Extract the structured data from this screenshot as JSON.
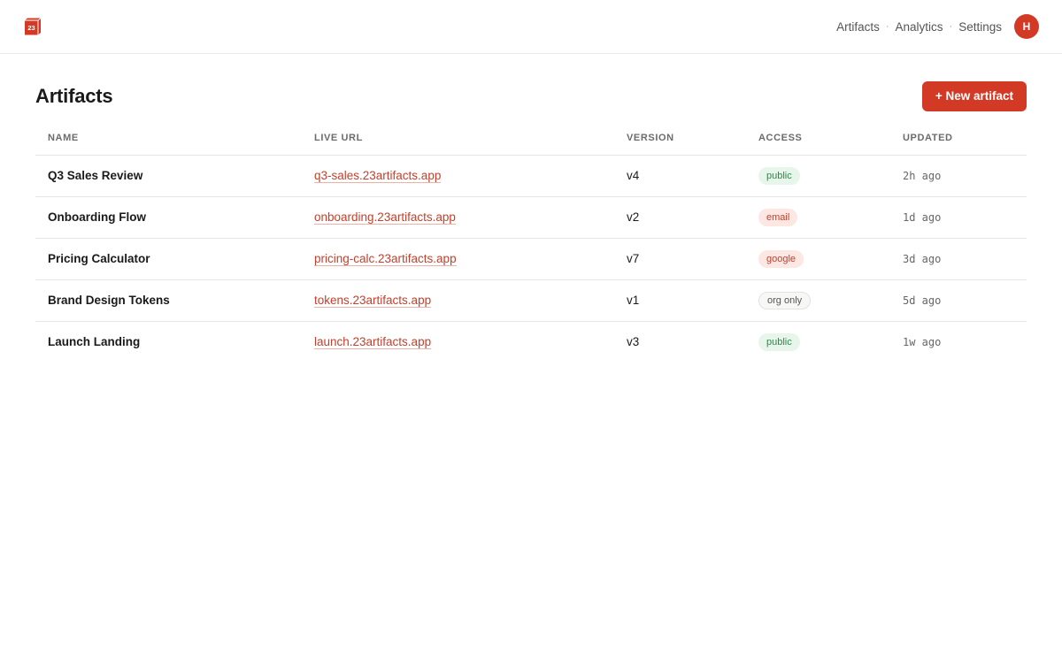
{
  "header": {
    "logo_text": "23",
    "nav": [
      "Artifacts",
      "Analytics",
      "Settings"
    ],
    "separator": "·",
    "avatar_initial": "H"
  },
  "main": {
    "title": "Artifacts",
    "new_button_label": "+ New artifact"
  },
  "table": {
    "columns": [
      "NAME",
      "LIVE URL",
      "VERSION",
      "ACCESS",
      "UPDATED"
    ],
    "rows": [
      {
        "name": "Q3 Sales Review",
        "url": "q3-sales.23artifacts.app",
        "version": "v4",
        "access": "public",
        "updated": "2h ago"
      },
      {
        "name": "Onboarding Flow",
        "url": "onboarding.23artifacts.app",
        "version": "v2",
        "access": "email",
        "updated": "1d ago"
      },
      {
        "name": "Pricing Calculator",
        "url": "pricing-calc.23artifacts.app",
        "version": "v7",
        "access": "google",
        "updated": "3d ago"
      },
      {
        "name": "Brand Design Tokens",
        "url": "tokens.23artifacts.app",
        "version": "v1",
        "access": "org only",
        "updated": "5d ago"
      },
      {
        "name": "Launch Landing",
        "url": "launch.23artifacts.app",
        "version": "v3",
        "access": "public",
        "updated": "1w ago"
      }
    ]
  },
  "colors": {
    "accent": "#d33a26",
    "link": "#c4402c",
    "public_badge_bg": "#e6f6ea",
    "public_badge_text": "#2c8a44",
    "restricted_badge_bg": "#fde7e3"
  },
  "icons": {
    "logo": "23-box-logo-icon"
  }
}
